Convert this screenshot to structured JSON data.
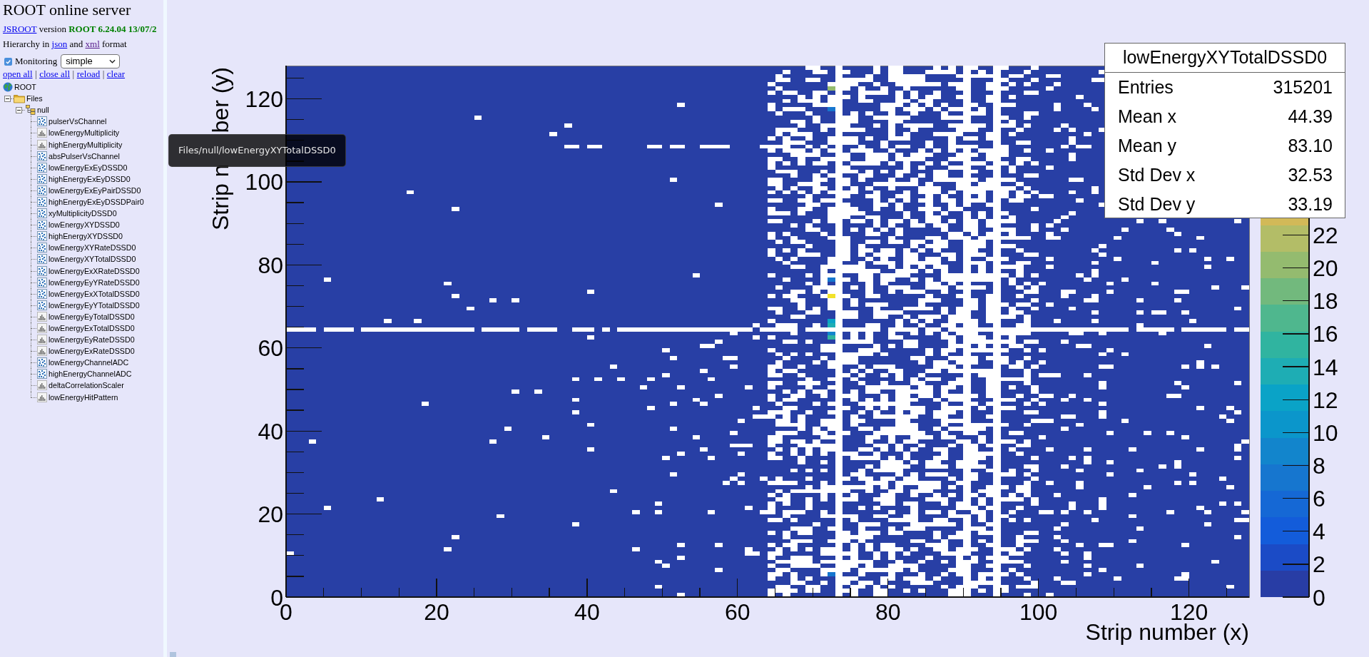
{
  "sidebar": {
    "title": "ROOT online server",
    "version_line": {
      "link": "JSROOT",
      "text": "version **ROOT 6.24.04 13/07/2**"
    },
    "hierarchy_line": {
      "before": "Hierarchy in",
      "links": [
        {
          "text": "json",
          "visited": false
        },
        {
          "text": "xml",
          "visited": true
        }
      ],
      "between": "and",
      "after": "format"
    },
    "monitoring": {
      "label": "Monitoring",
      "checked": true,
      "mode": "simple"
    },
    "actions": [
      {
        "label": "open all"
      },
      {
        "label": "close all"
      },
      {
        "label": "reload"
      },
      {
        "label": "clear"
      }
    ],
    "separators": [
      "|",
      "|",
      "|"
    ],
    "tree": [
      {
        "label": "ROOT",
        "kind": "root",
        "children": [
          {
            "label": "Files",
            "kind": "folder",
            "expanded": true,
            "children": [
              {
                "label": "null",
                "kind": "file",
                "expanded": true,
                "children": [
                  {
                    "label": "pulserVsChannel",
                    "kind": "th2"
                  },
                  {
                    "label": "lowEnergyMultiplicity",
                    "kind": "th1"
                  },
                  {
                    "label": "highEnergyMultiplicity",
                    "kind": "th1"
                  },
                  {
                    "label": "absPulserVsChannel",
                    "kind": "th2"
                  },
                  {
                    "label": "lowEnergyExEyDSSD0",
                    "kind": "th2"
                  },
                  {
                    "label": "highEnergyExEyDSSD0",
                    "kind": "th2"
                  },
                  {
                    "label": "lowEnergyExEyPairDSSD0",
                    "kind": "th2"
                  },
                  {
                    "label": "highEnergyExEyDSSDPair0",
                    "kind": "th2"
                  },
                  {
                    "label": "xyMultiplicityDSSD0",
                    "kind": "th2"
                  },
                  {
                    "label": "lowEnergyXYDSSD0",
                    "kind": "th2"
                  },
                  {
                    "label": "highEnergyXYDSSD0",
                    "kind": "th2"
                  },
                  {
                    "label": "lowEnergyXYRateDSSD0",
                    "kind": "th2"
                  },
                  {
                    "label": "lowEnergyXYTotalDSSD0",
                    "kind": "th2"
                  },
                  {
                    "label": "lowEnergyExXRateDSSD0",
                    "kind": "th2"
                  },
                  {
                    "label": "lowEnergyEyYRateDSSD0",
                    "kind": "th2"
                  },
                  {
                    "label": "lowEnergyExXTotalDSSD0",
                    "kind": "th2"
                  },
                  {
                    "label": "lowEnergyEyYTotalDSSD0",
                    "kind": "th2"
                  },
                  {
                    "label": "lowEnergyEyTotalDSSD0",
                    "kind": "th1"
                  },
                  {
                    "label": "lowEnergyExTotalDSSD0",
                    "kind": "th1"
                  },
                  {
                    "label": "lowEnergyEyRateDSSD0",
                    "kind": "th1"
                  },
                  {
                    "label": "lowEnergyExRateDSSD0",
                    "kind": "th1"
                  },
                  {
                    "label": "lowEnergyChannelADC",
                    "kind": "th2"
                  },
                  {
                    "label": "highEnergyChannelADC",
                    "kind": "th2"
                  },
                  {
                    "label": "deltaCorrelationScaler",
                    "kind": "th1"
                  },
                  {
                    "label": "lowEnergyHitPattern",
                    "kind": "th1"
                  }
                ]
              }
            ]
          }
        ]
      }
    ]
  },
  "tooltip": {
    "text": "Files/null/lowEnergyXYTotalDSSD0"
  },
  "histogram": {
    "x_axis": {
      "tick_labels": [
        "0",
        "20",
        "40",
        "60",
        "80",
        "100",
        "120"
      ],
      "title": "Strip number (x)"
    },
    "y_axis": {
      "title_end": "ber (y)",
      "title_start": "Strip n",
      "tick_labels": [
        "120",
        "100",
        "80",
        "60",
        "40",
        "20",
        "0"
      ]
    },
    "palette": {
      "tick_labels": [
        "22",
        "20",
        "18",
        "16",
        "14",
        "12",
        "10",
        "8",
        "6",
        "4",
        "2",
        "0"
      ]
    },
    "stats": {
      "title": "lowEnergyXYTotalDSSD0",
      "rows": [
        {
          "label": "Entries",
          "value": "315201"
        },
        {
          "label": "Mean x",
          "value": "44.39"
        },
        {
          "label": "Mean y",
          "value": "83.10"
        },
        {
          "label": "Std Dev x",
          "value": "32.53"
        },
        {
          "label": "Std Dev y",
          "value": "33.19"
        }
      ]
    }
  }
}
